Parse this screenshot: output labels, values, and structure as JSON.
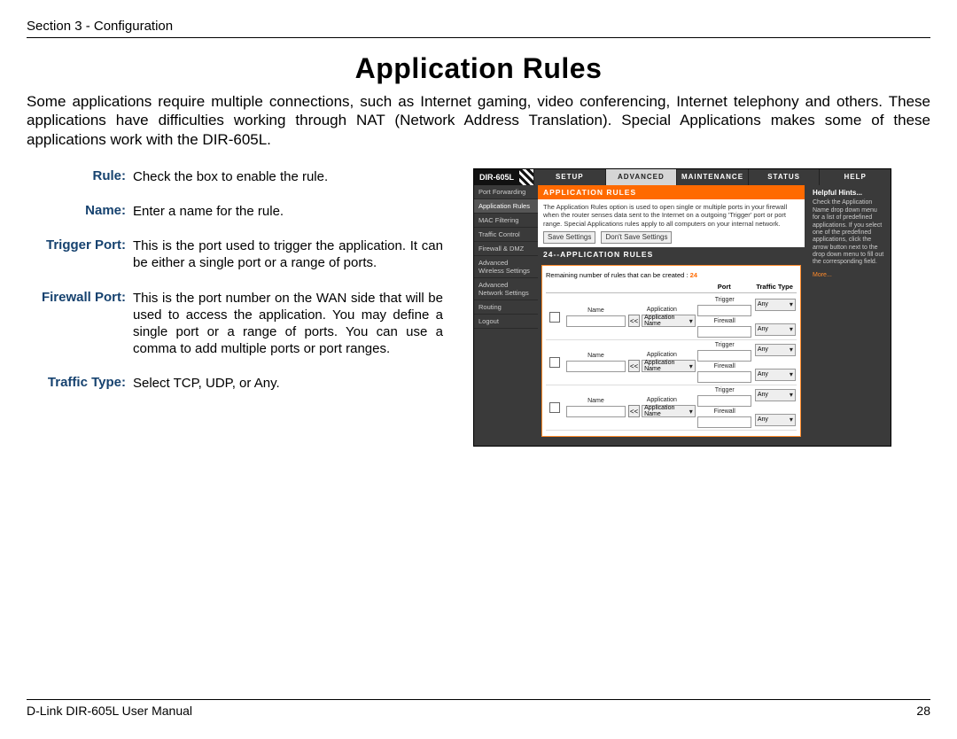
{
  "header": {
    "section": "Section 3 - Configuration"
  },
  "title": "Application Rules",
  "intro": "Some applications require multiple connections, such as Internet gaming, video conferencing, Internet telephony and others. These applications have difficulties working through NAT (Network Address Translation). Special Applications makes some of these applications work with the DIR-605L.",
  "defs": [
    {
      "term": "Rule:",
      "desc": "Check the box to enable the rule."
    },
    {
      "term": "Name:",
      "desc": "Enter a name for the rule."
    },
    {
      "term": "Trigger Port:",
      "desc": "This is the port used to trigger the application. It can be either a single port or a range of ports."
    },
    {
      "term": "Firewall Port:",
      "desc": "This is the port number on the WAN side that will be used to access the application. You may define a single port or a range of ports. You can use a comma to add multiple ports or port ranges."
    },
    {
      "term": "Traffic Type:",
      "desc": "Select TCP, UDP, or Any."
    }
  ],
  "router": {
    "model": "DIR-605L",
    "tabs": [
      "SETUP",
      "ADVANCED",
      "MAINTENANCE",
      "STATUS",
      "HELP"
    ],
    "sidebar": [
      "Port Forwarding",
      "Application Rules",
      "MAC Filtering",
      "Traffic Control",
      "Firewall & DMZ",
      "Advanced Wireless Settings",
      "Advanced Network Settings",
      "Routing",
      "Logout"
    ],
    "section1": {
      "title": "APPLICATION RULES",
      "desc": "The Application Rules option is used to open single or multiple ports in your firewall when the router senses data sent to the Internet on a outgoing 'Trigger' port or port range. Special Applications rules apply to all computers on your internal network."
    },
    "buttons": {
      "save": "Save Settings",
      "dont": "Don't Save Settings"
    },
    "section2": {
      "title": "24--APPLICATION RULES",
      "remain_prefix": "Remaining number of rules that can be created : ",
      "remain_count": "24",
      "cols": {
        "port": "Port",
        "traffic": "Traffic Type"
      },
      "labels": {
        "name": "Name",
        "application": "Application",
        "appname": "Application Name",
        "trigger": "Trigger",
        "firewall": "Firewall",
        "any": "Any"
      }
    },
    "hints": {
      "title": "Helpful Hints...",
      "text": "Check the Application Name drop down menu for a list of predefined applications. If you select one of the predefined applications, click the arrow button next to the drop down menu to fill out the corresponding field.",
      "more": "More..."
    }
  },
  "footer": {
    "left": "D-Link DIR-605L User Manual",
    "page": "28"
  }
}
